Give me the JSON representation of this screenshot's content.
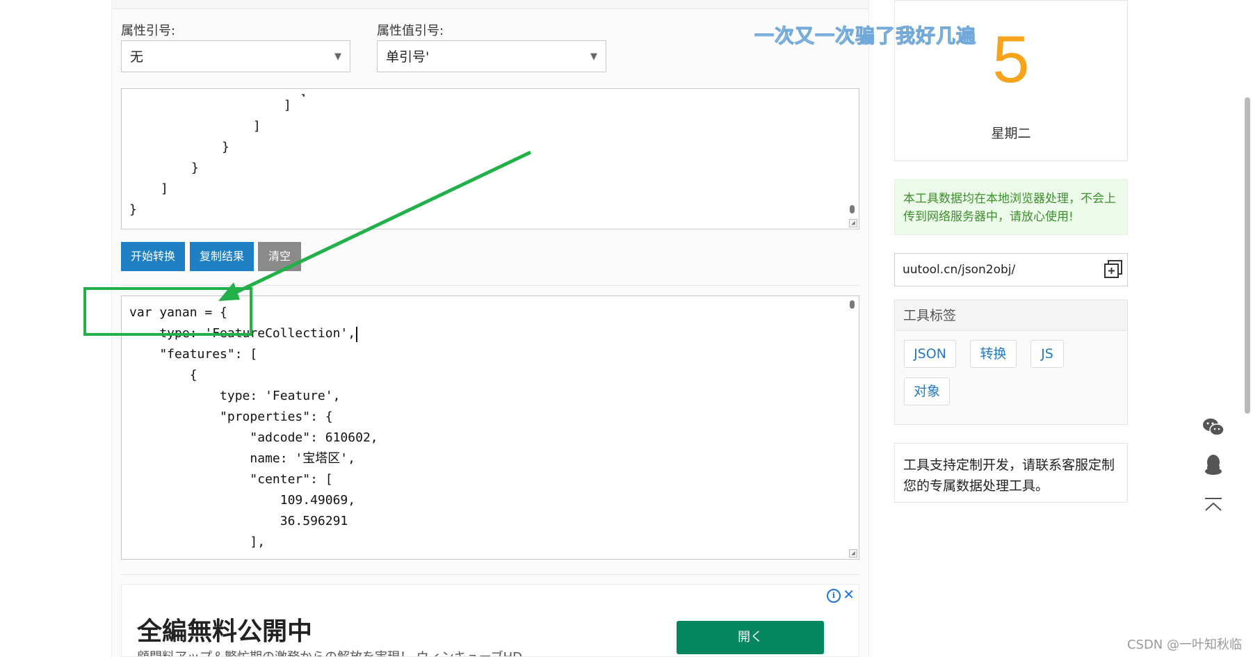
{
  "form": {
    "attr_quote_label": "属性引号:",
    "attr_quote_value": "无",
    "value_quote_label": "属性值引号:",
    "value_quote_value": "单引号'"
  },
  "input_code": {
    "lines": [
      "]",
      "]",
      "}",
      "}",
      "]",
      "}"
    ]
  },
  "buttons": {
    "convert": "开始转换",
    "copy": "复制结果",
    "clear": "清空"
  },
  "output_code": {
    "lines": [
      "var yanan = {",
      "    type: 'FeatureCollection',",
      "    \"features\": [",
      "        {",
      "            type: 'Feature',",
      "            \"properties\": {",
      "                \"adcode\": 610602,",
      "                name: '宝塔区',",
      "                \"center\": [",
      "                    109.49069,",
      "                    36.596291",
      "                ],"
    ]
  },
  "ad": {
    "title": "全編無料公開中",
    "subtitle": "顧問料アップ＆繁忙期の激務からの解放を実現！ ウィンキューブHD",
    "open_button": "開く",
    "info_icon": "i",
    "close_icon": "✕"
  },
  "date_card": {
    "day": "5",
    "weekday": "星期二"
  },
  "notice": "本工具数据均在本地浏览器处理，不会上传到网络服务器中，请放心使用!",
  "url": "uutool.cn/json2obj/",
  "tags": {
    "title": "工具标签",
    "items": [
      "JSON",
      "转换",
      "JS",
      "对象"
    ]
  },
  "custom_service": "工具支持定制开发，请联系客服定制您的专属数据处理工具。",
  "watermark": "一次又一次骗了我好几遍",
  "csdn": "CSDN @一叶知秋临",
  "colors": {
    "primary_button": "#1e7fc4",
    "accent_day": "#f7a31c",
    "notice_text": "#3c8f2c",
    "annotation_green": "#22b04b"
  }
}
